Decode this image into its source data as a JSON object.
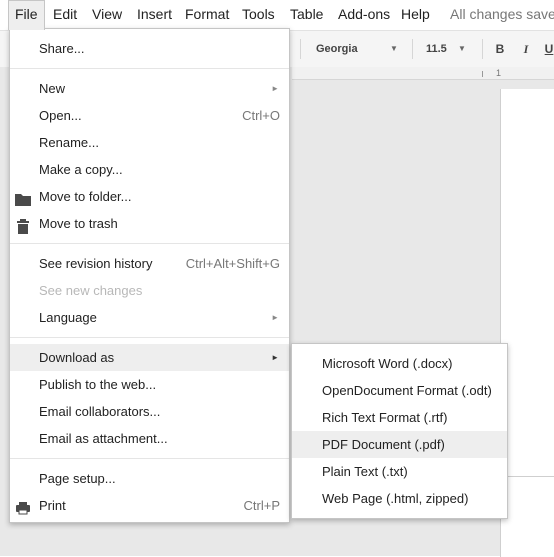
{
  "menubar": {
    "items": [
      {
        "label": "File"
      },
      {
        "label": "Edit"
      },
      {
        "label": "View"
      },
      {
        "label": "Insert"
      },
      {
        "label": "Format"
      },
      {
        "label": "Tools"
      },
      {
        "label": "Table"
      },
      {
        "label": "Add-ons"
      },
      {
        "label": "Help"
      }
    ],
    "save_status": "All changes saved"
  },
  "toolbar": {
    "font": "Georgia",
    "font_size": "11.5",
    "bold": "B",
    "italic": "I",
    "underline": "U"
  },
  "ruler": {
    "number": "1"
  },
  "file_menu": {
    "items": [
      {
        "label": "Share..."
      },
      {
        "label": "New",
        "submenu": true
      },
      {
        "label": "Open...",
        "shortcut": "Ctrl+O"
      },
      {
        "label": "Rename..."
      },
      {
        "label": "Make a copy..."
      },
      {
        "label": "Move to folder...",
        "icon": "folder-icon"
      },
      {
        "label": "Move to trash",
        "icon": "trash-icon"
      },
      {
        "label": "See revision history",
        "shortcut": "Ctrl+Alt+Shift+G"
      },
      {
        "label": "See new changes",
        "disabled": true
      },
      {
        "label": "Language",
        "submenu": true
      },
      {
        "label": "Download as",
        "submenu": true,
        "highlighted": true
      },
      {
        "label": "Publish to the web..."
      },
      {
        "label": "Email collaborators..."
      },
      {
        "label": "Email as attachment..."
      },
      {
        "label": "Page setup..."
      },
      {
        "label": "Print",
        "shortcut": "Ctrl+P",
        "icon": "printer-icon"
      }
    ]
  },
  "download_submenu": {
    "items": [
      {
        "label": "Microsoft Word (.docx)"
      },
      {
        "label": "OpenDocument Format (.odt)"
      },
      {
        "label": "Rich Text Format (.rtf)"
      },
      {
        "label": "PDF Document (.pdf)",
        "highlighted": true
      },
      {
        "label": "Plain Text (.txt)"
      },
      {
        "label": "Web Page (.html, zipped)"
      }
    ]
  },
  "colors": {
    "menu_highlight": "#eeeeee",
    "disabled_text": "#b8b8b8",
    "shortcut_text": "#777777",
    "toolbar_bg": "#f5f5f5",
    "doc_bg": "#e8e8e8"
  }
}
